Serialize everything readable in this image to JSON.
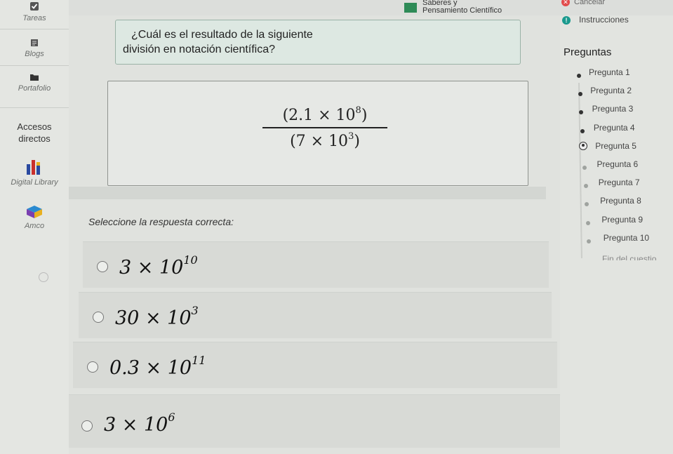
{
  "header": {
    "subject_line1": "Saberes y",
    "subject_line2": "Pensamiento Científico",
    "cancel_label": "Cancelar"
  },
  "sidebar": {
    "items": [
      {
        "label": "Tareas",
        "icon": "check-icon"
      },
      {
        "label": "Blogs",
        "icon": "document-icon"
      },
      {
        "label": "Portafolio",
        "icon": "folder-icon"
      },
      {
        "label": "Accesos directos",
        "line1": "Accesos",
        "line2": "directos"
      },
      {
        "label": "Digital Library",
        "icon": "library-icon"
      },
      {
        "label": "Amco",
        "icon": "cube-icon"
      }
    ]
  },
  "question": {
    "text_line1": "¿Cuál es el resultado de la siguiente",
    "text_line2": "división en notación científica?",
    "numerator_base": "(2.1 × 10",
    "numerator_exp": "8",
    "numerator_close": ")",
    "denominator_base": "(7 × 10",
    "denominator_exp": "3",
    "denominator_close": ")",
    "instruction": "Seleccione la respuesta correcta:"
  },
  "options": [
    {
      "base": "3 × 10",
      "exp": "10"
    },
    {
      "base": "30 × 10",
      "exp": "3"
    },
    {
      "base": "0.3 × 10",
      "exp": "11"
    },
    {
      "base": "3 × 10",
      "exp": "6"
    }
  ],
  "right_panel": {
    "instructions_label": "Instrucciones",
    "title": "Preguntas",
    "questions": [
      {
        "label": "Pregunta 1",
        "state": "done"
      },
      {
        "label": "Pregunta 2",
        "state": "done"
      },
      {
        "label": "Pregunta 3",
        "state": "done"
      },
      {
        "label": "Pregunta 4",
        "state": "done"
      },
      {
        "label": "Pregunta 5",
        "state": "current"
      },
      {
        "label": "Pregunta 6",
        "state": "pending"
      },
      {
        "label": "Pregunta 7",
        "state": "pending"
      },
      {
        "label": "Pregunta 8",
        "state": "pending"
      },
      {
        "label": "Pregunta 9",
        "state": "pending"
      },
      {
        "label": "Pregunta 10",
        "state": "pending"
      }
    ],
    "end_label": "Fin del cuestio"
  },
  "colors": {
    "accent_green": "#2e8b57",
    "info_teal": "#1a9a8e",
    "cancel_red": "#e24b4b"
  }
}
